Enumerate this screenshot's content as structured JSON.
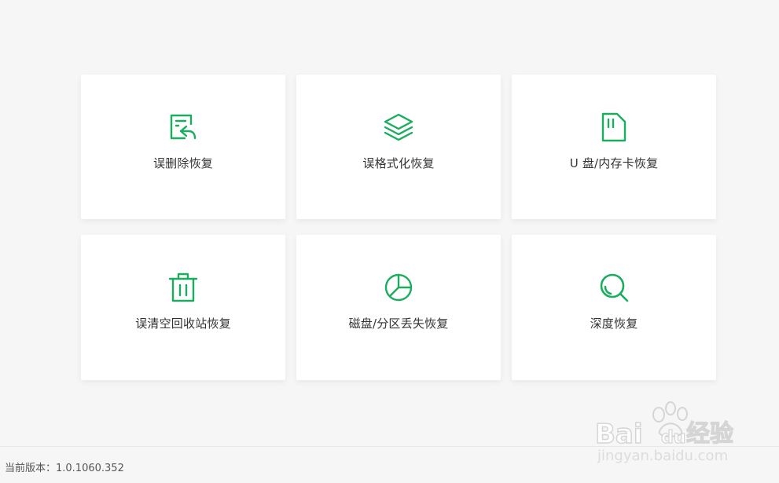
{
  "accent_color": "#1aad5e",
  "cards": [
    {
      "label": "误删除恢复",
      "icon": "file-undo-icon"
    },
    {
      "label": "误格式化恢复",
      "icon": "layers-icon"
    },
    {
      "label": "U 盘/内存卡恢复",
      "icon": "sd-card-icon"
    },
    {
      "label": "误清空回收站恢复",
      "icon": "trash-icon"
    },
    {
      "label": "磁盘/分区丢失恢复",
      "icon": "pie-chart-icon"
    },
    {
      "label": "深度恢复",
      "icon": "search-icon"
    }
  ],
  "footer": {
    "version_text": "当前版本：1.0.1060.352"
  },
  "watermark": {
    "brand": "Baidu经验",
    "url": "jingyan.baidu.com"
  }
}
